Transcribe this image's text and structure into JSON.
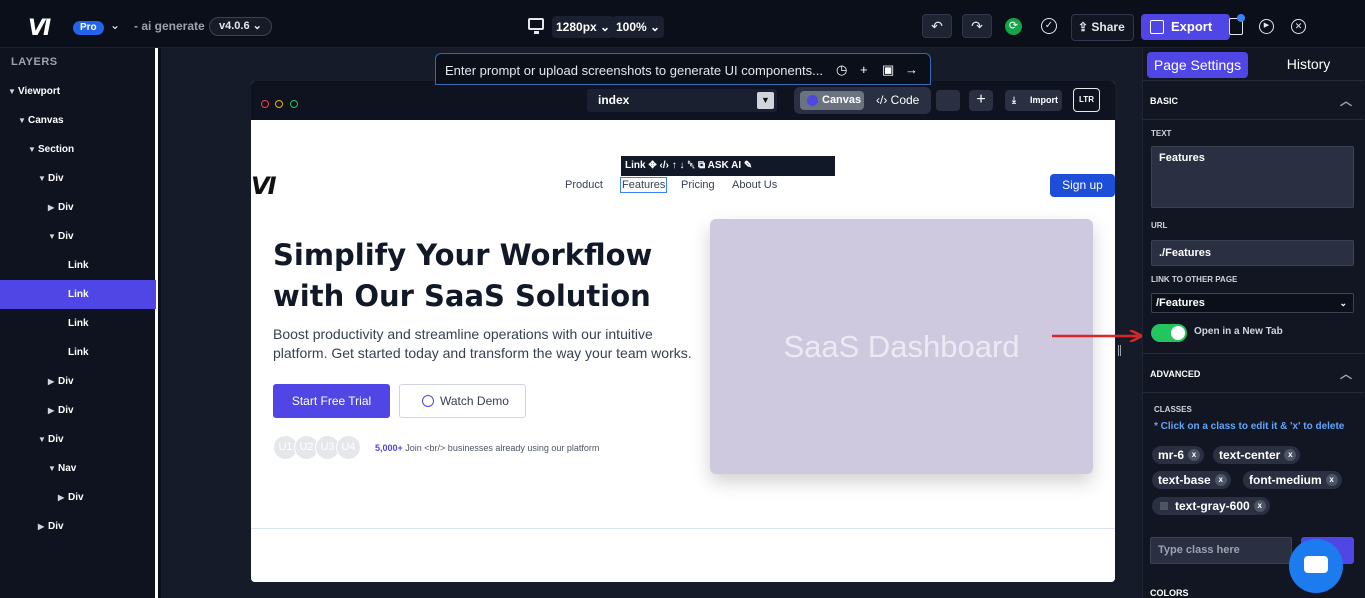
{
  "topbar": {
    "logo": "VI",
    "plan_badge": "Pro",
    "app_name": "- ai generate",
    "version": "v4.0.6",
    "resolution": "1280px",
    "zoom": "100%",
    "share_label": "Share",
    "export_label": "Export"
  },
  "layers": {
    "title": "LAYERS",
    "items": [
      {
        "label": "Viewport",
        "depth": 0,
        "caret": "▼"
      },
      {
        "label": "Canvas",
        "depth": 1,
        "caret": "▼"
      },
      {
        "label": "Section",
        "depth": 2,
        "caret": "▼"
      },
      {
        "label": "Div",
        "depth": 3,
        "caret": "▼"
      },
      {
        "label": "Div",
        "depth": 4,
        "caret": "▶"
      },
      {
        "label": "Div",
        "depth": 4,
        "caret": "▼"
      },
      {
        "label": "Link",
        "depth": 5,
        "caret": ""
      },
      {
        "label": "Link",
        "depth": 5,
        "caret": "",
        "active": true
      },
      {
        "label": "Link",
        "depth": 5,
        "caret": ""
      },
      {
        "label": "Link",
        "depth": 5,
        "caret": ""
      },
      {
        "label": "Div",
        "depth": 4,
        "caret": "▶"
      },
      {
        "label": "Div",
        "depth": 4,
        "caret": "▶"
      },
      {
        "label": "Div",
        "depth": 3,
        "caret": "▼"
      },
      {
        "label": "Nav",
        "depth": 4,
        "caret": "▼"
      },
      {
        "label": "Div",
        "depth": 5,
        "caret": "▶"
      },
      {
        "label": "Div",
        "depth": 3,
        "caret": "▶"
      }
    ]
  },
  "prompt": {
    "placeholder": "Enter prompt or upload screenshots to generate UI components..."
  },
  "frame": {
    "page": "index",
    "mode_canvas": "Canvas",
    "mode_code": "Code",
    "import_label": "Import",
    "dir_label": "LTR"
  },
  "site": {
    "logo": "VI",
    "nav": [
      "Product",
      "Features",
      "Pricing",
      "About Us"
    ],
    "signup": "Sign up",
    "toolbar_label": "Link ✥ ‹/› ↑ ↓ ␡ ⧉ ASK AI ✎",
    "hero_title": "Simplify Your Workflow with Our SaaS Solution",
    "hero_sub": "Boost productivity and streamline operations with our intuitive platform. Get started today and transform the way your team works.",
    "cta_primary": "Start Free Trial",
    "cta_secondary": "Watch Demo",
    "avatars": [
      "U1",
      "U2",
      "U3",
      "U4"
    ],
    "social_count": "5,000+",
    "social_text": " Join <br/> businesses already using our platform",
    "dashboard_text": "SaaS Dashboard"
  },
  "right": {
    "tab_active": "Page Settings",
    "tab_other": "History",
    "basic_head": "BASIC",
    "text_label": "TEXT",
    "text_value": "Features",
    "url_label": "URL",
    "url_value": "./Features",
    "link_other_label": "LINK TO OTHER PAGE",
    "link_other_value": "/Features",
    "new_tab_label": "Open in a New Tab",
    "advanced_head": "ADVANCED",
    "classes_label": "CLASSES",
    "classes_note": "* Click on a class to edit it & 'x' to delete",
    "classes": [
      "mr-6",
      "text-center",
      "text-base",
      "font-medium",
      "text-gray-600"
    ],
    "class_placeholder": "Type class here",
    "colors_head": "COLORS"
  }
}
